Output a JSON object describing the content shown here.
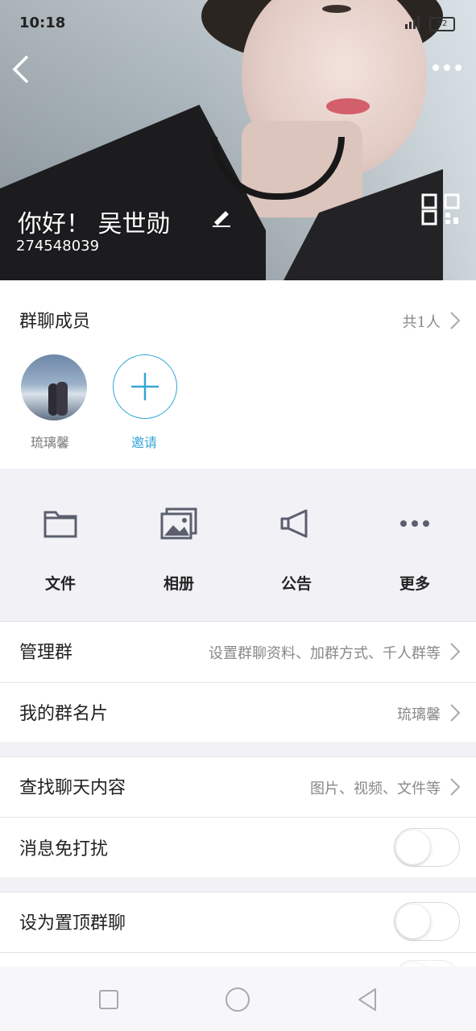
{
  "status_bar": {
    "time": "10:18",
    "battery": "52"
  },
  "header": {
    "greeting": "你好！ 吴世勋",
    "group_id": "274548039"
  },
  "members": {
    "title": "群聊成员",
    "count": "共1人",
    "list": [
      {
        "name": "琉璃馨"
      }
    ],
    "invite_label": "邀请"
  },
  "tools": [
    {
      "label": "文件",
      "icon": "folder-icon"
    },
    {
      "label": "相册",
      "icon": "album-icon"
    },
    {
      "label": "公告",
      "icon": "megaphone-icon"
    },
    {
      "label": "更多",
      "icon": "more-dots-icon"
    }
  ],
  "settings": {
    "manage": {
      "label": "管理群",
      "value": "设置群聊资料、加群方式、千人群等"
    },
    "card": {
      "label": "我的群名片",
      "value": "琉璃馨"
    },
    "search": {
      "label": "查找聊天内容",
      "value": "图片、视频、文件等"
    },
    "mute": {
      "label": "消息免打扰",
      "on": false
    },
    "pin": {
      "label": "设为置顶群聊",
      "on": false
    }
  },
  "colors": {
    "accent": "#33a6d6",
    "icon_gray": "#5b5f6e"
  }
}
